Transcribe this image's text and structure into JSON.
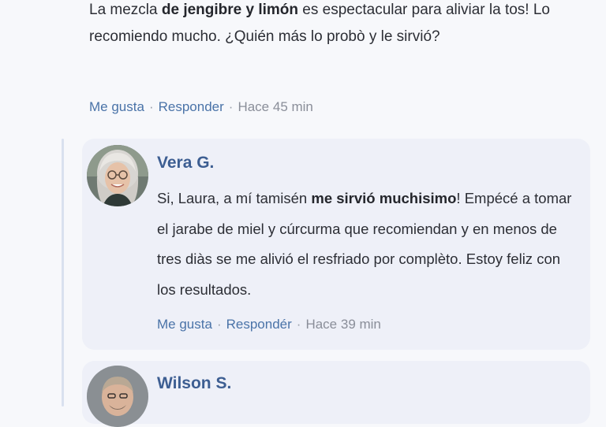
{
  "top_comment": {
    "text_parts": [
      {
        "text": "La mezcla ",
        "bold": false
      },
      {
        "text": "de jengibre y limón",
        "bold": true
      },
      {
        "text": " es espectacular para aliviar la tos! Lo recomiendo mucho. ¿Quién más lo probò y le sirvió?",
        "bold": false
      }
    ],
    "actions": {
      "like": "Me gusta",
      "reply": "Responder",
      "time": "Hace 45 min"
    }
  },
  "replies": [
    {
      "author": "Vera G.",
      "avatar_icon": "avatar-photo",
      "text_parts": [
        {
          "text": "Si, Laura, a mí tamisén ",
          "bold": false
        },
        {
          "text": "me sirvió muchisimo",
          "bold": true
        },
        {
          "text": "! Empécé a tomar el jarabe de miel y cúrcurma que recomiendan y en menos de tres diàs se me alivió el resfriado por complèto. Estoy feliz con los resultados.",
          "bold": false
        }
      ],
      "actions": {
        "like": "Me gusta",
        "reply": "Respondér",
        "time": "Hace 39 min"
      }
    },
    {
      "author": "Wilson S.",
      "avatar_icon": "avatar-photo"
    }
  ],
  "separator": "·",
  "colors": {
    "link": "#4a73a8",
    "author": "#3d5e92",
    "card": "#eef0f8",
    "thread": "#d9e1ef"
  }
}
